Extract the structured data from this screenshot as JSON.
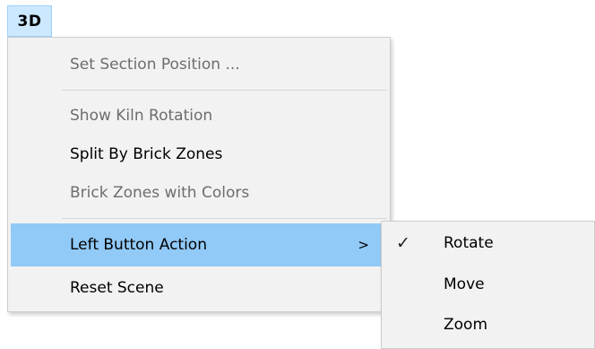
{
  "menubar": {
    "title": "3D"
  },
  "menu": {
    "items": [
      {
        "label": "Set Section Position ...",
        "enabled": false
      },
      {
        "label": "Show Kiln Rotation",
        "enabled": false
      },
      {
        "label": "Split By Brick Zones",
        "enabled": true
      },
      {
        "label": "Brick Zones with Colors",
        "enabled": false
      },
      {
        "label": "Left Button Action",
        "enabled": true,
        "has_submenu": true,
        "highlighted": true,
        "arrow": ">"
      },
      {
        "label": "Reset Scene",
        "enabled": true
      }
    ]
  },
  "submenu": {
    "items": [
      {
        "label": "Rotate",
        "checked": true,
        "check_glyph": "✓"
      },
      {
        "label": "Move",
        "checked": false
      },
      {
        "label": "Zoom",
        "checked": false
      }
    ]
  },
  "colors": {
    "highlight": "#91c9f7",
    "menubar_active": "#cce8ff",
    "menu_background": "#f2f2f2",
    "disabled_text": "#6d6d6d"
  }
}
